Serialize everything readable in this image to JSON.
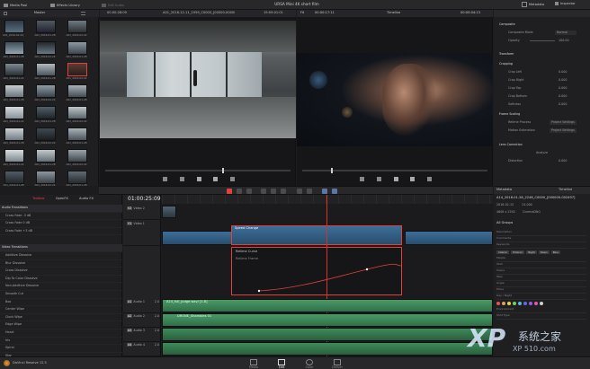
{
  "menu": {
    "tabs": [
      {
        "label": "Media Pool"
      },
      {
        "label": "Effects Library"
      },
      {
        "label": "Edit Index"
      }
    ],
    "project_title": "URSA Mini 4K short film",
    "right_tabs": [
      {
        "label": "Metadata"
      },
      {
        "label": "Inspector"
      }
    ]
  },
  "media_pool": {
    "header": "Master",
    "clips": [
      "A01_2016-02-22_1951",
      "A01_2016-01-28",
      "A01_2016-02-22",
      "A01_2016-01-28",
      "A01_2016-02-22",
      "A01_2016-01-28",
      "A01_2016-02-22",
      "A01_2016-01-28",
      "A01_2016-02-22",
      "A01_2016-01-28",
      "A01_2016-02-22",
      "A01_2016-01-28",
      "A01_2016-02-22",
      "A01_2016-01-28",
      "A01_2016-02-22",
      "A01_2016-01-28",
      "A01_2016-02-22",
      "A01_2016-01-28",
      "A01_2016-02-22",
      "A01_2016-01-28",
      "A01_2016-02-22",
      "A01_2016-01-28",
      "A01_2016-02-22",
      "A01_2016-01-28"
    ]
  },
  "viewers": {
    "source_timecode": "00:00:28:09",
    "source_clip": "A01_2016-12-11_1959_C0000_[00000-00000].dng",
    "source_duration": "19:09:01:01",
    "timeline_zoom": "Fit",
    "timeline_duration": "00:00:17:11",
    "timeline_name": "Timeline",
    "timeline_clip": "A14_2016-01-28_2246_C0000_[000000-002497]",
    "timeline_tc": "00:00:04:13"
  },
  "effects": {
    "tabs": [
      "Toolbox",
      "OpenFX",
      "Audio FX"
    ],
    "timecode": "01:00:25:09",
    "audio_header": "Audio Transitions",
    "audio_items": [
      "Cross Fade -3 dB",
      "Cross Fade 0 dB",
      "Cross Fade +3 dB"
    ],
    "video_header": "Video Transitions",
    "video_items": [
      "Additive Dissolve",
      "Blur Dissolve",
      "Cross Dissolve",
      "Dip To Color Dissolve",
      "Non-Additive Dissolve",
      "Smooth Cut",
      "Box",
      "Center Wipe",
      "Clock Wipe",
      "Edge Wipe",
      "Heart",
      "Iris",
      "Spiral",
      "Star",
      "Push"
    ]
  },
  "timeline": {
    "video_tracks": [
      {
        "name": "Video 2",
        "label": "V2"
      },
      {
        "name": "Video 1",
        "label": "V1"
      }
    ],
    "audio_tracks": [
      {
        "name": "Audio 1",
        "label": "A1",
        "level": "2.0"
      },
      {
        "name": "Audio 2",
        "label": "A2",
        "level": "2.0"
      },
      {
        "name": "Audio 3",
        "label": "A3",
        "level": "2.0"
      },
      {
        "name": "Audio 4",
        "label": "A4",
        "level": "2.0"
      }
    ],
    "curve_panel": {
      "title": "Retime Curve",
      "sub": "Retime Frame"
    },
    "speed_label": "Speed Change",
    "audio_clip_1": "A14_full_judge.wav/ [1.8]",
    "audio_clip_2": "DRONE_Shambles 01"
  },
  "inspector": {
    "composite": {
      "header": "Composite",
      "mode_label": "Composite Mode",
      "mode_value": "Normal",
      "opacity_label": "Opacity",
      "opacity_value": "100.00"
    },
    "transform_header": "Transform",
    "cropping": {
      "header": "Cropping",
      "rows": [
        {
          "label": "Crop Left",
          "value": "0.000"
        },
        {
          "label": "Crop Right",
          "value": "0.000"
        },
        {
          "label": "Crop Top",
          "value": "0.000"
        },
        {
          "label": "Crop Bottom",
          "value": "0.000"
        },
        {
          "label": "Softness",
          "value": "0.000"
        }
      ]
    },
    "scaling": {
      "header": "Frame Scaling",
      "rows": [
        {
          "label": "Retime Process",
          "value": "Project Settings"
        },
        {
          "label": "Motion Estimation",
          "value": "Project Settings"
        }
      ]
    },
    "lens": {
      "header": "Lens Correction",
      "analyze": "Analyze",
      "distortion_label": "Distortion",
      "distortion_value": "0.000"
    }
  },
  "metadata": {
    "header": "Metadata",
    "tab": "Timeline",
    "clip": "A14_2016-01-28_2246_C0000_[000000-002497]",
    "date": "2016-02-15",
    "fps": "24.000",
    "res": "4608 x 2592",
    "codec": "CinemaDNG",
    "groups_header": "All Groups",
    "fields": [
      "Description",
      "Comments",
      "Keywords",
      "People",
      "Shot",
      "Scene",
      "Take",
      "Angle",
      "Move",
      "Day / Night",
      "Environment",
      "Shot Type"
    ],
    "keywords": [
      "Interior",
      "Exterior",
      "Night",
      "Dawn",
      "Blue"
    ],
    "swatch_colors": [
      "#e05656",
      "#e0a256",
      "#e0d256",
      "#7ad056",
      "#56b8e0",
      "#5670e0",
      "#a056e0",
      "#e056b0",
      "#cfcfcf"
    ]
  },
  "bottom": {
    "app": "DaVinci Resolve 12.5",
    "pages": [
      {
        "label": "Media"
      },
      {
        "label": "Edit"
      },
      {
        "label": "Color"
      },
      {
        "label": "Deliver"
      }
    ],
    "watermark": "系统之家",
    "watermark_sub": "XP 510.com"
  },
  "colors": {
    "accent_red": "#e2413b",
    "clip_blue": "#3c6e9a",
    "audio_green": "#3f8a5a",
    "playhead": "#d8302a"
  }
}
